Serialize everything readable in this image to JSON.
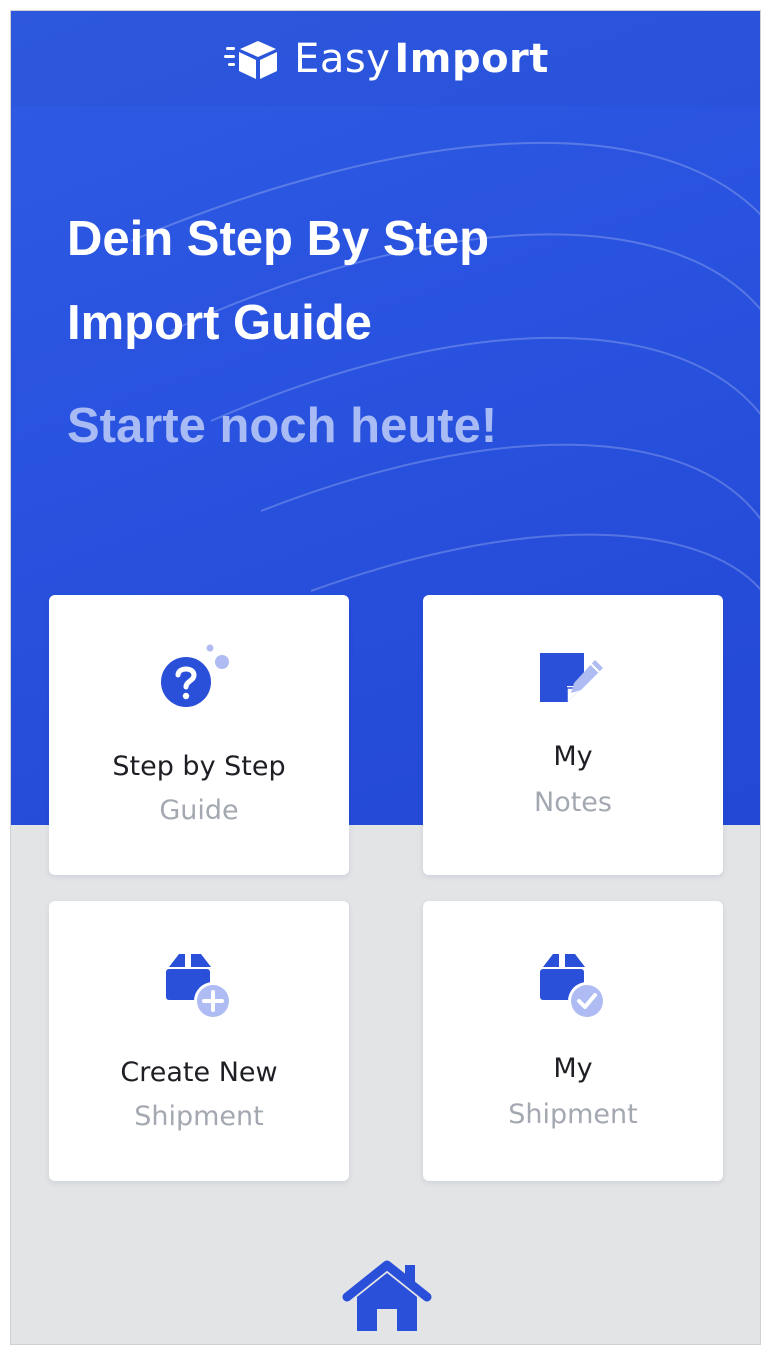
{
  "brand": {
    "light": "Easy",
    "bold": "Import"
  },
  "hero": {
    "headline_line1": "Dein Step By Step",
    "headline_line2": "Import Guide",
    "tagline": "Starte noch heute!"
  },
  "cards": [
    {
      "title": "Step by Step",
      "subtitle": "Guide",
      "icon": "help-circle-icon"
    },
    {
      "title": "My",
      "subtitle": "Notes",
      "icon": "note-edit-icon"
    },
    {
      "title": "Create New",
      "subtitle": "Shipment",
      "icon": "package-add-icon"
    },
    {
      "title": "My",
      "subtitle": "Shipment",
      "icon": "package-check-icon"
    }
  ],
  "nav": {
    "home_icon": "home-icon"
  },
  "colors": {
    "primary": "#2852df",
    "primary_dark": "#2348d4",
    "icon_blue": "#2a4fd8",
    "icon_light": "#aebcf3",
    "tagline": "#a9bbf5",
    "background": "#e3e4e6"
  }
}
